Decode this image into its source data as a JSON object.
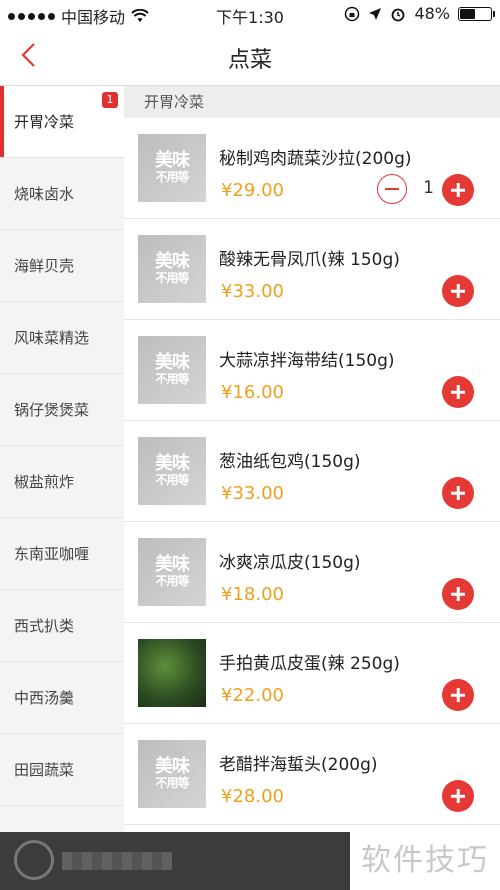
{
  "status_bar": {
    "carrier": "中国移动",
    "time": "下午1:30",
    "battery": "48%",
    "battery_level": 0.48
  },
  "nav": {
    "title": "点菜"
  },
  "sidebar": {
    "items": [
      {
        "label": "开胃冷菜",
        "badge": "1"
      },
      {
        "label": "烧味卤水"
      },
      {
        "label": "海鲜贝壳"
      },
      {
        "label": "风味菜精选"
      },
      {
        "label": "锅仔煲煲菜"
      },
      {
        "label": "椒盐煎炸"
      },
      {
        "label": "东南亚咖喱"
      },
      {
        "label": "西式扒类"
      },
      {
        "label": "中西汤羹"
      },
      {
        "label": "田园蔬菜"
      }
    ]
  },
  "section": {
    "title": "开胃冷菜"
  },
  "placeholder_image_text": {
    "line1": "美味",
    "line2": "不用等"
  },
  "dishes": [
    {
      "name": "秘制鸡肉蔬菜沙拉(200g)",
      "price": "¥29.00",
      "qty": "1"
    },
    {
      "name": "酸辣无骨凤爪(辣 150g)",
      "price": "¥33.00"
    },
    {
      "name": "大蒜凉拌海带结(150g)",
      "price": "¥16.00"
    },
    {
      "name": "葱油纸包鸡(150g)",
      "price": "¥33.00"
    },
    {
      "name": "冰爽凉瓜皮(150g)",
      "price": "¥18.00"
    },
    {
      "name": "手拍黄瓜皮蛋(辣 250g)",
      "price": "¥22.00"
    },
    {
      "name": "老醋拌海蜇头(200g)",
      "price": "¥28.00"
    }
  ],
  "watermark": "软件技巧",
  "colors": {
    "accent": "#e53935",
    "price": "#f0a020"
  }
}
